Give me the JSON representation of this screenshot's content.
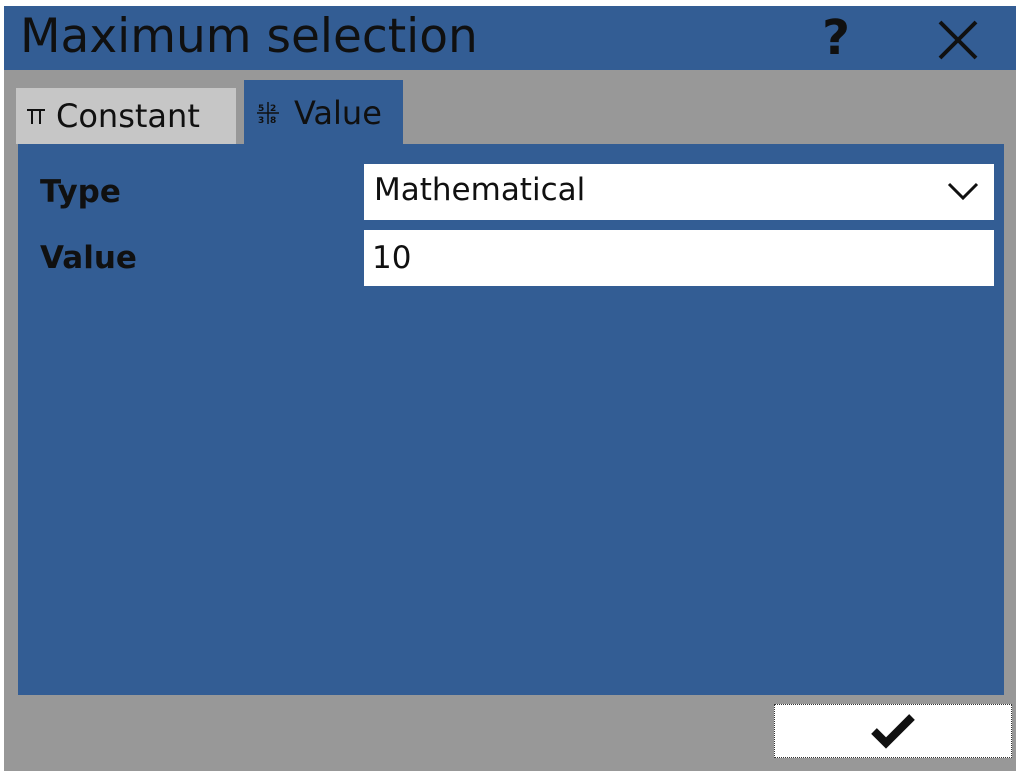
{
  "dialog": {
    "title": "Maximum selection",
    "help_label": "?"
  },
  "tabs": [
    {
      "label": "Constant",
      "icon": "pi-icon",
      "active": false
    },
    {
      "label": "Value",
      "icon": "value-grid-icon",
      "active": true
    }
  ],
  "form": {
    "type_label": "Type",
    "type_value": "Mathematical",
    "value_label": "Value",
    "value_value": "10"
  },
  "colors": {
    "accent_blue": "#335d94",
    "background_gray": "#989898",
    "inactive_tab": "#c6c6c6"
  }
}
